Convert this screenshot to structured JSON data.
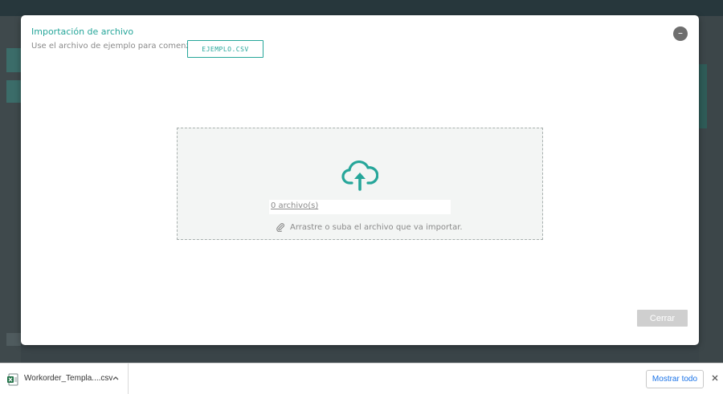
{
  "modal": {
    "title": "Importación de archivo",
    "subtitle": "Use el archivo de ejemplo para comenzar.",
    "sample_button_label": "EJEMPLO.CSV",
    "minimize_label": "–",
    "dropzone": {
      "file_count": "0 archivo(s)",
      "hint": "Arrastre o suba el archivo que va importar."
    },
    "close_button_label": "Cerrar"
  },
  "download_bar": {
    "filename": "Workorder_Templa....csv",
    "show_all_label": "Mostrar todo"
  },
  "colors": {
    "accent": "#26a69a",
    "muted_text": "#8a8a8a",
    "disabled_button": "#cfcfcf",
    "link_blue": "#1a73e8"
  },
  "icons": {
    "upload": "cloud-upload-icon",
    "attachment": "paperclip-icon",
    "excel": "excel-file-icon"
  }
}
